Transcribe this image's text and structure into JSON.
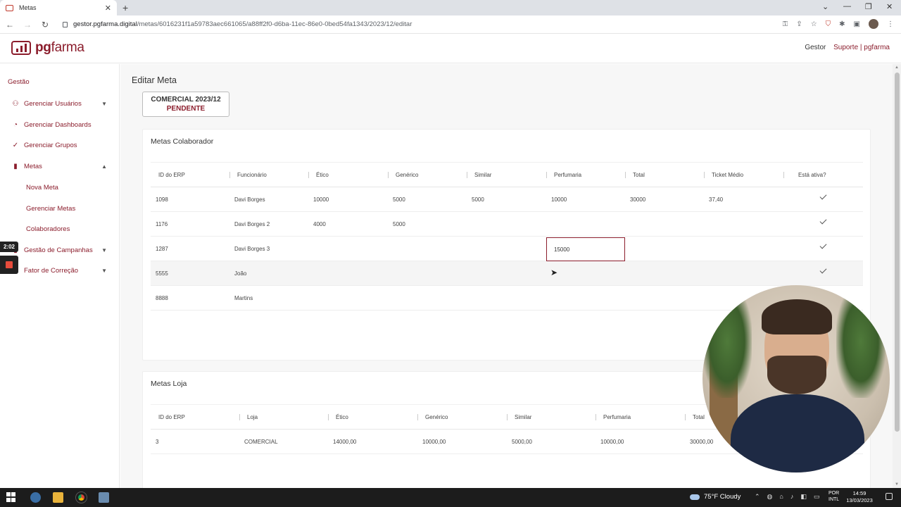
{
  "browser": {
    "tab_title": "Metas",
    "url_host": "gestor.pgfarma.digital",
    "url_path": "/metas/6016231f1a59783aec661065/a88ff2f0-d6ba-11ec-86e0-0bed54fa1343/2023/12/editar"
  },
  "header": {
    "logo_prefix": "pg",
    "logo_suffix": "farma",
    "gestor_label": "Gestor",
    "suporte_label": "Suporte | pgfarma"
  },
  "sidebar": {
    "section": "Gestão",
    "items": [
      {
        "label": "Gerenciar Usuários"
      },
      {
        "label": "Gerenciar Dashboards"
      },
      {
        "label": "Gerenciar Grupos"
      },
      {
        "label": "Metas"
      },
      {
        "label": "Gestão de Campanhas"
      },
      {
        "label": "Fator de Correção"
      }
    ],
    "subitems": [
      {
        "label": "Nova Meta"
      },
      {
        "label": "Gerenciar Metas"
      },
      {
        "label": "Colaboradores"
      }
    ],
    "rec_time": "2:02"
  },
  "main": {
    "page_title": "Editar Meta",
    "status_line1": "COMERCIAL 2023/12",
    "status_line2": "PENDENTE",
    "colab": {
      "title": "Metas Colaborador",
      "headers": [
        "ID do ERP",
        "Funcionário",
        "Ético",
        "Genérico",
        "Similar",
        "Perfumaria",
        "Total",
        "Ticket Médio",
        "Está ativa?"
      ],
      "rows": [
        {
          "id": "1098",
          "nome": "Davi Borges",
          "etico": "10000",
          "generico": "5000",
          "similar": "5000",
          "perfumaria": "10000",
          "total": "30000",
          "ticket": "37,40",
          "ativa": true
        },
        {
          "id": "1176",
          "nome": "Davi Borges 2",
          "etico": "4000",
          "generico": "5000",
          "similar": "",
          "perfumaria": "",
          "total": "",
          "ticket": "",
          "ativa": true
        },
        {
          "id": "1287",
          "nome": "Davi Borges 3",
          "etico": "",
          "generico": "",
          "similar": "",
          "perfumaria": "15000",
          "total": "",
          "ticket": "",
          "ativa": true
        },
        {
          "id": "5555",
          "nome": "João",
          "etico": "",
          "generico": "",
          "similar": "",
          "perfumaria": "",
          "total": "",
          "ticket": "",
          "ativa": true
        },
        {
          "id": "8888",
          "nome": "Martins",
          "etico": "",
          "generico": "",
          "similar": "",
          "perfumaria": "",
          "total": "",
          "ticket": "",
          "ativa": false
        }
      ]
    },
    "loja": {
      "title": "Metas Loja",
      "headers": [
        "ID do ERP",
        "Loja",
        "Ético",
        "Genérico",
        "Similar",
        "Perfumaria",
        "Total"
      ],
      "rows": [
        {
          "id": "3",
          "loja": "COMERCIAL",
          "etico": "14000,00",
          "generico": "10000,00",
          "similar": "5000,00",
          "perfumaria": "10000,00",
          "total": "30000,00"
        }
      ]
    }
  },
  "taskbar": {
    "weather": "75°F Cloudy",
    "lang1": "POR",
    "lang2": "INTL",
    "time": "14:59",
    "date": "13/03/2023"
  },
  "colors": {
    "brand": "#8b1d2c"
  }
}
